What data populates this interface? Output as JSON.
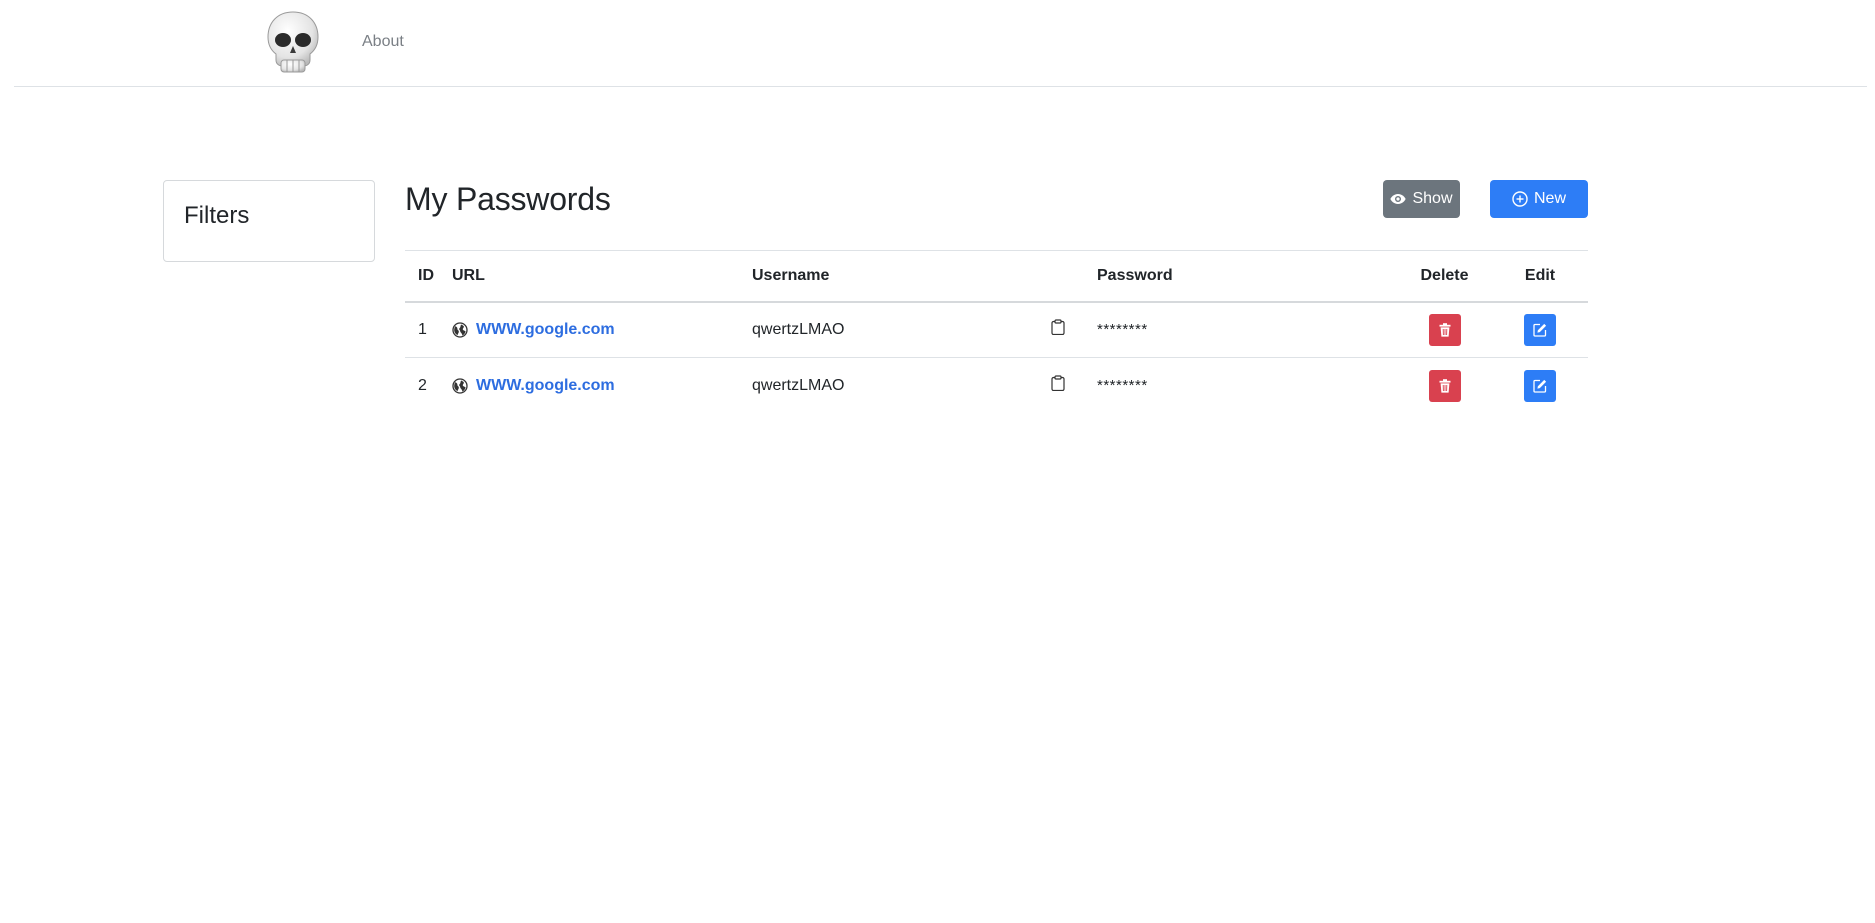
{
  "nav": {
    "logo_icon": "skull-icon",
    "about_label": "About"
  },
  "filters": {
    "title": "Filters"
  },
  "main": {
    "title": "My Passwords",
    "show_button": {
      "label": "Show",
      "icon": "eye-icon"
    },
    "new_button": {
      "label": "New",
      "icon": "plus-circle-icon"
    }
  },
  "table": {
    "headers": {
      "id": "ID",
      "url": "URL",
      "username": "Username",
      "password": "Password",
      "delete": "Delete",
      "edit": "Edit"
    },
    "rows": [
      {
        "id": "1",
        "url": "WWW.google.com",
        "username": "qwertzLMAO",
        "password": "********"
      },
      {
        "id": "2",
        "url": "WWW.google.com",
        "username": "qwertzLMAO",
        "password": "********"
      }
    ]
  },
  "colors": {
    "primary": "#2d7df6",
    "secondary": "#6c757d",
    "danger": "#d9414f",
    "link": "#2d6de0"
  }
}
